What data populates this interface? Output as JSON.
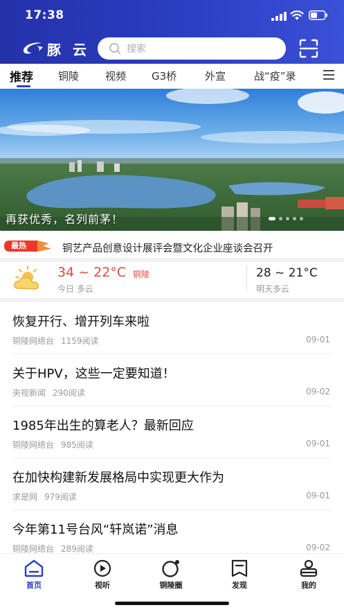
{
  "status_bar": {
    "time": "17:38"
  },
  "header": {
    "logo_text": "豚 云",
    "search_placeholder": "搜索",
    "colors": {
      "primary": "#2a3fc4",
      "accent": "#e04a3a"
    }
  },
  "tabs": [
    {
      "label": "推荐",
      "active": true
    },
    {
      "label": "铜陵"
    },
    {
      "label": "视频"
    },
    {
      "label": "G3桥"
    },
    {
      "label": "外宣"
    },
    {
      "label": "战“疫”录"
    }
  ],
  "banner": {
    "caption": "再获优秀，名列前茅！",
    "pages": 5,
    "current_page": 1
  },
  "hot_news": {
    "badge": "最热",
    "headline": "铜艺产品创意设计展评会暨文化企业座谈会召开"
  },
  "weather": {
    "today_temp": "34 ~ 22°C",
    "city": "铜陵",
    "today_label": "今日 多云",
    "tomorrow_temp": "28 ~ 21°C",
    "tomorrow_label": "明天多云"
  },
  "news": [
    {
      "title": "恢复开行、增开列车来啦",
      "source": "铜陵网络台",
      "reads": "1159阅读",
      "date": "09-01"
    },
    {
      "title": "关于HPV，这些一定要知道！",
      "source": "央视新闻",
      "reads": "290阅读",
      "date": "09-02"
    },
    {
      "title": "1985年出生的算老人？最新回应",
      "source": "铜陵网络台",
      "reads": "985阅读",
      "date": "09-01"
    },
    {
      "title": "在加快构建新发展格局中实现更大作为",
      "source": "求是网",
      "reads": "979阅读",
      "date": "09-01"
    },
    {
      "title": "今年第11号台风“轩岚诺”消息",
      "source": "铜陵网络台",
      "reads": "289阅读",
      "date": "09-02"
    }
  ],
  "bottom_nav": [
    {
      "label": "首页",
      "icon": "home-icon",
      "active": true
    },
    {
      "label": "视听",
      "icon": "play-icon"
    },
    {
      "label": "铜陵圈",
      "icon": "circle-icon"
    },
    {
      "label": "发现",
      "icon": "discover-icon"
    },
    {
      "label": "我的",
      "icon": "profile-icon"
    }
  ]
}
